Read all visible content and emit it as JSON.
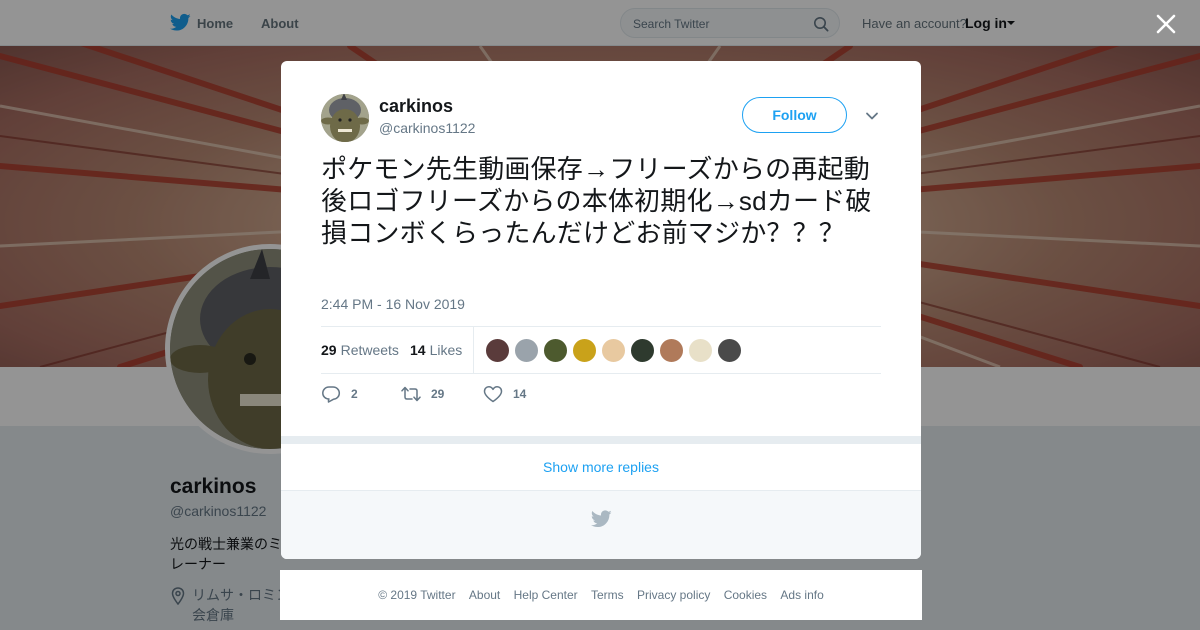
{
  "nav": {
    "home_label": "Home",
    "about_label": "About",
    "search_placeholder": "Search Twitter",
    "account_prompt": "Have an account?",
    "login_label": "Log in"
  },
  "profile": {
    "name": "carkinos",
    "handle": "@carkinos1122",
    "bio": "光の戦士兼業のミ レーナー",
    "location": "リムサ・ロミン 会倉庫"
  },
  "tweet": {
    "author_name": "carkinos",
    "author_handle": "@carkinos1122",
    "follow_label": "Follow",
    "text": "ポケモン先生動画保存→フリーズからの再起動後ロゴフリーズからの本体初期化→sdカード破損コンボくらったんだけどお前マジか？？？",
    "timestamp": "2:44 PM - 16 Nov 2019",
    "retweets_count": "29",
    "retweets_label": "Retweets",
    "likes_count": "14",
    "likes_label": "Likes",
    "reply_count": "2",
    "retweet_action_count": "29",
    "like_action_count": "14",
    "liker_avatar_colors": [
      "#5a3b3b",
      "#9aa3ab",
      "#4d5a2e",
      "#c9a21a",
      "#e8c9a0",
      "#2e3a2e",
      "#b07a5a",
      "#e8e0c8",
      "#4a4a4a"
    ]
  },
  "show_more_label": "Show more replies",
  "footer": {
    "copyright": "© 2019 Twitter",
    "links": [
      "About",
      "Help Center",
      "Terms",
      "Privacy policy",
      "Cookies",
      "Ads info"
    ]
  },
  "colors": {
    "brand_blue": "#1da1f2",
    "secondary_text": "#657786",
    "modal_bg": "#ffffff"
  }
}
